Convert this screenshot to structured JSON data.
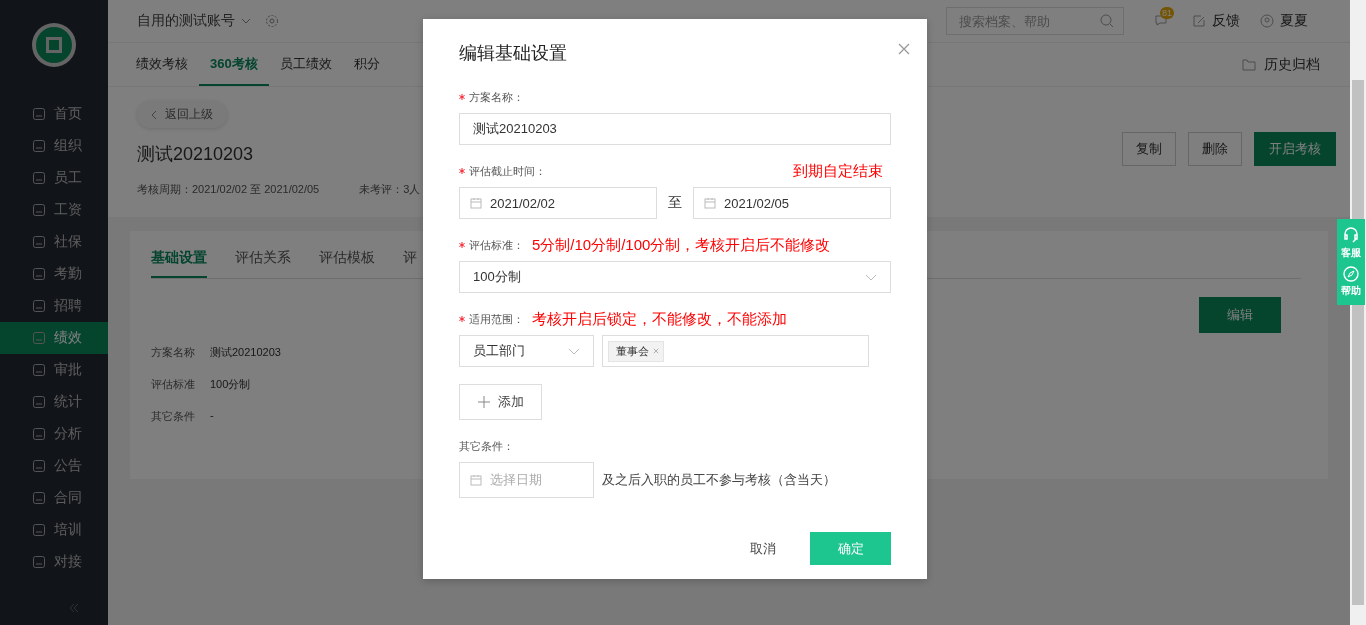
{
  "header": {
    "account": "自用的测试账号",
    "search": {
      "placeholder": "搜索档案、帮助"
    },
    "badge": "81",
    "feedback": "反馈",
    "user": "夏夏"
  },
  "sidebar": {
    "items": [
      {
        "label": "首页",
        "selected": false
      },
      {
        "label": "组织",
        "selected": false
      },
      {
        "label": "员工",
        "selected": false
      },
      {
        "label": "工资",
        "selected": false
      },
      {
        "label": "社保",
        "selected": false
      },
      {
        "label": "考勤",
        "selected": false
      },
      {
        "label": "招聘",
        "selected": false
      },
      {
        "label": "绩效",
        "selected": true
      },
      {
        "label": "审批",
        "selected": false
      },
      {
        "label": "统计",
        "selected": false
      },
      {
        "label": "分析",
        "selected": false
      },
      {
        "label": "公告",
        "selected": false
      },
      {
        "label": "合同",
        "selected": false
      },
      {
        "label": "培训",
        "selected": false
      },
      {
        "label": "对接",
        "selected": false
      }
    ]
  },
  "tabs": [
    {
      "label": "绩效考核",
      "selected": false
    },
    {
      "label": "360考核",
      "selected": true
    },
    {
      "label": "员工绩效",
      "selected": false
    },
    {
      "label": "积分",
      "selected": false
    }
  ],
  "archive": "历史归档",
  "detail": {
    "back": "返回上级",
    "title": "测试20210203",
    "meta": [
      "考核周期：2021/02/02 至 2021/02/05",
      "未考评：3人"
    ],
    "actions": [
      "复制",
      "删除",
      "开启考核"
    ],
    "tabs": [
      {
        "label": "基础设置",
        "selected": true
      },
      {
        "label": "评估关系",
        "selected": false
      },
      {
        "label": "评估模板",
        "selected": false
      },
      {
        "label": "评",
        "selected": false
      }
    ],
    "edit": "编辑",
    "info": [
      {
        "label": "方案名称",
        "value": "测试20210203"
      },
      {
        "label": "评估标准",
        "value": "100分制"
      },
      {
        "label": "其它条件",
        "value": "-"
      }
    ]
  },
  "float": [
    "客服",
    "帮助"
  ],
  "dialog": {
    "title": "编辑基础设置",
    "fields": [
      {
        "kind": "text",
        "label": "方案名称：",
        "required": true,
        "value": "测试20210203"
      },
      {
        "kind": "range",
        "label": "评估截止时间：",
        "required": true,
        "note": "到期自定结束",
        "start": "2021/02/02",
        "separator": "至",
        "end": "2021/02/05"
      },
      {
        "kind": "select",
        "label": "评估标准：",
        "required": true,
        "note": "5分制/10分制/100分制，考核开启后不能修改",
        "value": "100分制"
      },
      {
        "kind": "scope",
        "label": "适用范围：",
        "required": true,
        "note": "考核开启后锁定，不能修改，不能添加",
        "value": "员工部门",
        "tags": [
          "董事会"
        ],
        "add": "添加"
      },
      {
        "kind": "date",
        "label": "其它条件：",
        "required": false,
        "placeholder": "选择日期",
        "suffix": "及之后入职的员工不参与考核（含当天）"
      }
    ],
    "cancel": "取消",
    "ok": "确定"
  }
}
